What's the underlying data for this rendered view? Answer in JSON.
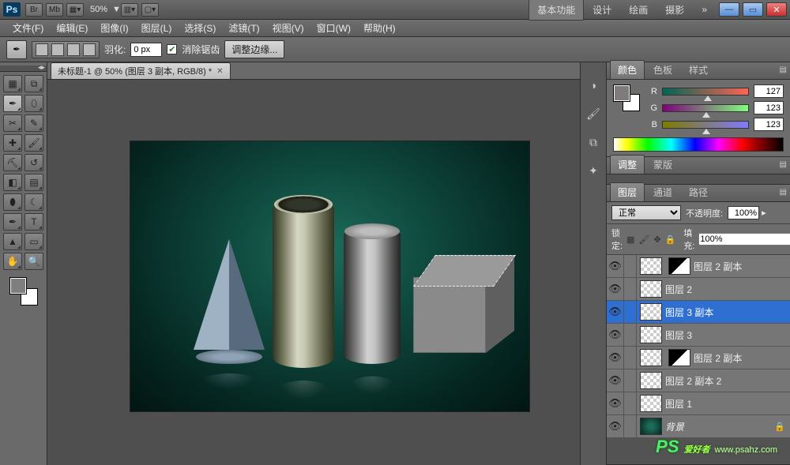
{
  "titlebar": {
    "ps": "Ps",
    "br": "Br",
    "mb": "Mb",
    "zoom": "50%",
    "workspaces": [
      "基本功能",
      "设计",
      "绘画",
      "摄影"
    ],
    "more": "»"
  },
  "menu": {
    "file": "文件(F)",
    "edit": "编辑(E)",
    "image": "图像(I)",
    "layer": "图层(L)",
    "select": "选择(S)",
    "filter": "滤镜(T)",
    "view": "视图(V)",
    "window": "窗口(W)",
    "help": "帮助(H)"
  },
  "options": {
    "feather_label": "羽化:",
    "feather_value": "0 px",
    "antialias": "消除锯齿",
    "refine_edge": "调整边缘..."
  },
  "document": {
    "tab_title": "未标题-1 @ 50% (图层 3 副本, RGB/8) *"
  },
  "color_panel": {
    "tabs": [
      "颜色",
      "色板",
      "样式"
    ],
    "r_label": "R",
    "r_value": "127",
    "g_label": "G",
    "g_value": "123",
    "b_label": "B",
    "b_value": "123"
  },
  "adjust_panel": {
    "tabs": [
      "调整",
      "蒙版"
    ]
  },
  "layers_panel": {
    "tabs": [
      "图层",
      "通道",
      "路径"
    ],
    "blend_mode": "正常",
    "opacity_label": "不透明度:",
    "opacity_value": "100%",
    "lock_label": "锁定:",
    "fill_label": "填充:",
    "fill_value": "100%",
    "layers": [
      {
        "name": "图层 2 副本",
        "mask": true
      },
      {
        "name": "图层 2"
      },
      {
        "name": "图层 3 副本",
        "selected": true
      },
      {
        "name": "图层 3"
      },
      {
        "name": "图层 2 副本",
        "mask": true
      },
      {
        "name": "图层 2 副本 2"
      },
      {
        "name": "图层 1"
      },
      {
        "name": "背景",
        "bg": true,
        "locked": true
      }
    ]
  },
  "watermark": {
    "brand": "PS",
    "text": "爱好者",
    "url": "www.psahz.com"
  }
}
